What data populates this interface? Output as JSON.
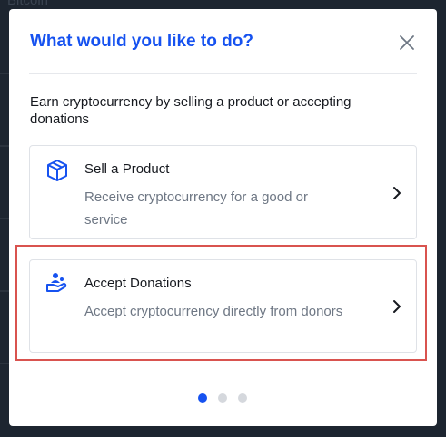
{
  "background": {
    "title": "Bitcoin"
  },
  "modal": {
    "title": "What would you like to do?",
    "subtitle": "Earn cryptocurrency by selling a product or accepting donations",
    "options": [
      {
        "title": "Sell a Product",
        "description": "Receive cryptocurrency for a good or service",
        "icon": "box-icon"
      },
      {
        "title": "Accept Donations",
        "description": "Accept cryptocurrency directly from donors",
        "icon": "donation-hand-icon"
      }
    ],
    "pagination": {
      "total": 3,
      "active": 1
    },
    "colors": {
      "accent": "#1652f0",
      "highlight": "#d9534f"
    }
  }
}
